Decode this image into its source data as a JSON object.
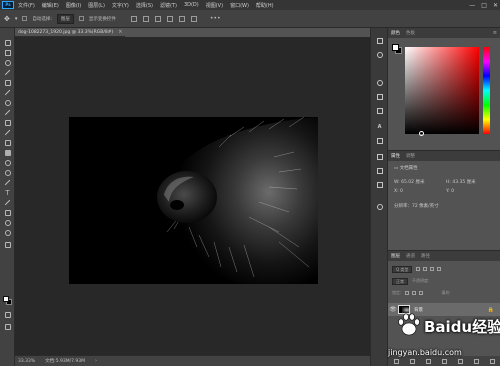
{
  "menubar": {
    "logo": "Ps",
    "items": [
      "文件(F)",
      "编辑(E)",
      "图像(I)",
      "图层(L)",
      "文字(Y)",
      "选择(S)",
      "滤镜(T)",
      "3D(D)",
      "视图(V)",
      "窗口(W)",
      "帮助(H)"
    ],
    "controls": [
      "—",
      "□",
      "✕"
    ]
  },
  "options": {
    "move_icon": "move-icon",
    "auto_select_label": "自动选择:",
    "auto_select_value": "图层",
    "transform_label": "显示变换控件",
    "more": "•••"
  },
  "document": {
    "tab_label": "dog-1082273_1920.jpg @ 33.3%(RGB/8#)",
    "tab_close": "×",
    "zoom": "33.33%",
    "doc_size": "文档:5.93M/7.93M",
    "status_arrow": "›"
  },
  "color_panel": {
    "tabs": [
      "颜色",
      "色板"
    ],
    "menu": "≡",
    "foreground": "#ffffff",
    "background": "#000000"
  },
  "properties_panel": {
    "tabs": [
      "属性",
      "调整"
    ],
    "title": "文档属性",
    "w_label": "W:",
    "w_value": "65.02 厘米",
    "h_label": "H:",
    "h_value": "43.35 厘米",
    "x_label": "X:",
    "x_value": "0",
    "y_label": "Y:",
    "y_value": "0",
    "resolution": "分辨率：72 像素/英寸"
  },
  "layers_panel": {
    "tabs": [
      "图层",
      "通道",
      "路径"
    ],
    "kind_filter": "Q 类型",
    "blend_mode": "正常",
    "opacity_label": "不透明度:",
    "lock_label": "锁定:",
    "fill_label": "填充:",
    "layer_name": "背景",
    "layer_eye": "👁",
    "layer_lock": "🔒"
  },
  "watermark": {
    "brand": "Baidu经验",
    "url": "jingyan.baidu.com"
  }
}
